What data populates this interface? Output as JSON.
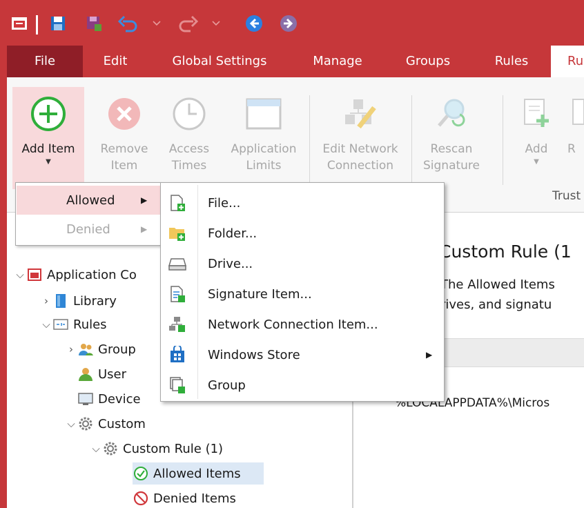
{
  "menu_tabs": [
    "File",
    "Edit",
    "Global Settings",
    "Manage",
    "Groups",
    "Rules",
    "Ru"
  ],
  "ribbon": {
    "buttons": [
      {
        "line1": "Add Item",
        "line2": "",
        "enabled": true
      },
      {
        "line1": "Remove",
        "line2": "Item",
        "enabled": false
      },
      {
        "line1": "Access",
        "line2": "Times",
        "enabled": false
      },
      {
        "line1": "Application",
        "line2": "Limits",
        "enabled": false
      },
      {
        "line1": "Edit Network",
        "line2": "Connection",
        "enabled": false
      },
      {
        "line1": "Rescan",
        "line2": "Signature",
        "enabled": false
      },
      {
        "line1": "Add",
        "line2": "",
        "enabled": false
      },
      {
        "line1": "R",
        "line2": "",
        "enabled": false
      }
    ],
    "group_label": "Trust"
  },
  "dropdown_primary": [
    "Allowed",
    "Denied"
  ],
  "dropdown_secondary": [
    "File...",
    "Folder...",
    "Drive...",
    "Signature Item...",
    "Network Connection Item...",
    "Windows Store",
    "Group"
  ],
  "tree": {
    "root": "Application Co",
    "library": "Library",
    "rules": "Rules",
    "group": "Group",
    "user": "User",
    "device": "Device",
    "custom": "Custom",
    "custom_rule": "Custom Rule (1)",
    "allowed_items": "Allowed Items",
    "denied_items": "Denied Items"
  },
  "content": {
    "title": "Custom Rule (1",
    "desc_line1": "The Allowed Items",
    "desc_line2": "rives, and signatu",
    "path": "%LOCALAPPDATA%\\Micros"
  },
  "colors": {
    "brand": "#c6373a",
    "file_tab": "#8f1e27",
    "highlight": "#f8d9db",
    "green": "#2fae3a"
  }
}
